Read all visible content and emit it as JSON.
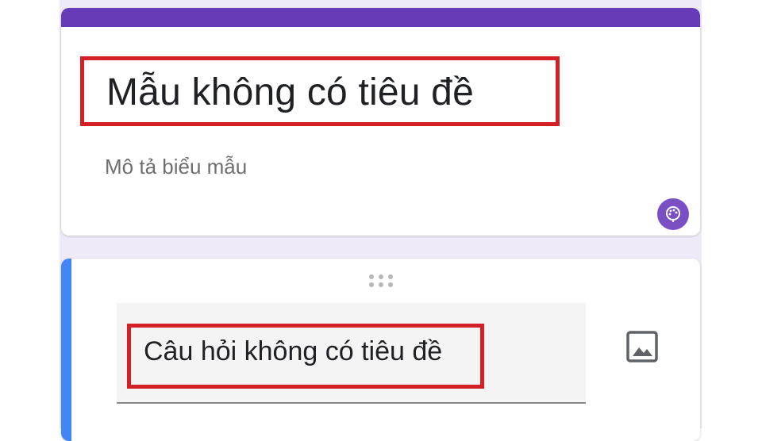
{
  "form": {
    "title": "Mẫu không có tiêu đề",
    "description": "Mô tả biểu mẫu",
    "accent_color": "#673ab7"
  },
  "question": {
    "title": "Câu hỏi không có tiêu đề",
    "accent_color": "#4285f4"
  },
  "icons": {
    "palette": "palette-icon",
    "drag": "drag-handle-icon",
    "image": "image-icon"
  },
  "highlight_color": "#d31f26"
}
